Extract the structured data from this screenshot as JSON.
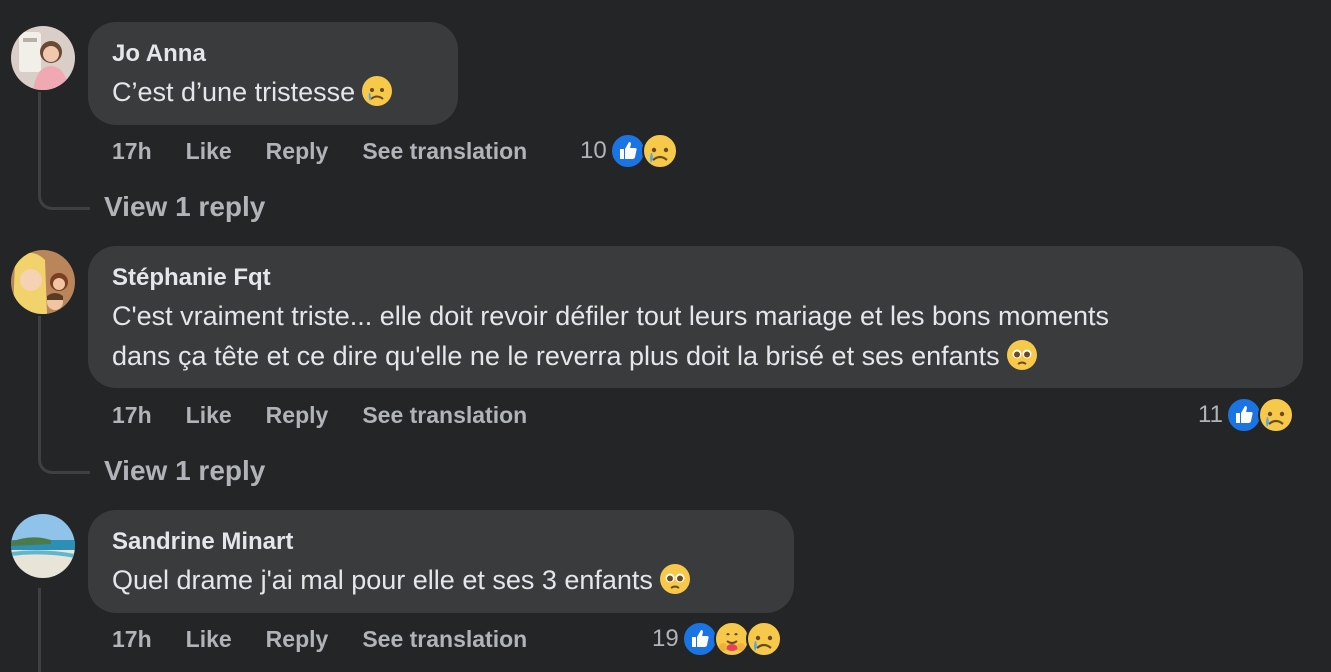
{
  "comments": [
    {
      "author": "Jo Anna",
      "text": "C’est d’une tristesse",
      "time": "17h",
      "like": "Like",
      "reply": "Reply",
      "translate": "See translation",
      "reaction_count": "10",
      "reactions": [
        "like",
        "sad"
      ],
      "view_replies": "View 1 reply"
    },
    {
      "author": "Stéphanie Fqt",
      "text_line1": "C'est vraiment triste... elle doit revoir défiler tout leurs mariage et les bons moments",
      "text_line2": "dans ça tête et ce dire qu'elle ne le reverra plus doit la brisé et ses enfants",
      "time": "17h",
      "like": "Like",
      "reply": "Reply",
      "translate": "See translation",
      "reaction_count": "11",
      "reactions": [
        "like",
        "sad"
      ],
      "view_replies": "View 1 reply"
    },
    {
      "author": "Sandrine Minart",
      "text": "Quel drame j'ai mal pour elle et ses 3 enfants",
      "time": "17h",
      "like": "Like",
      "reply": "Reply",
      "translate": "See translation",
      "reaction_count": "19",
      "reactions": [
        "like",
        "care",
        "sad"
      ]
    }
  ],
  "colors": {
    "background": "#242526",
    "bubble": "#3a3b3c",
    "like_blue": "#1b74e4",
    "secondary_text": "#b0b3b8"
  }
}
